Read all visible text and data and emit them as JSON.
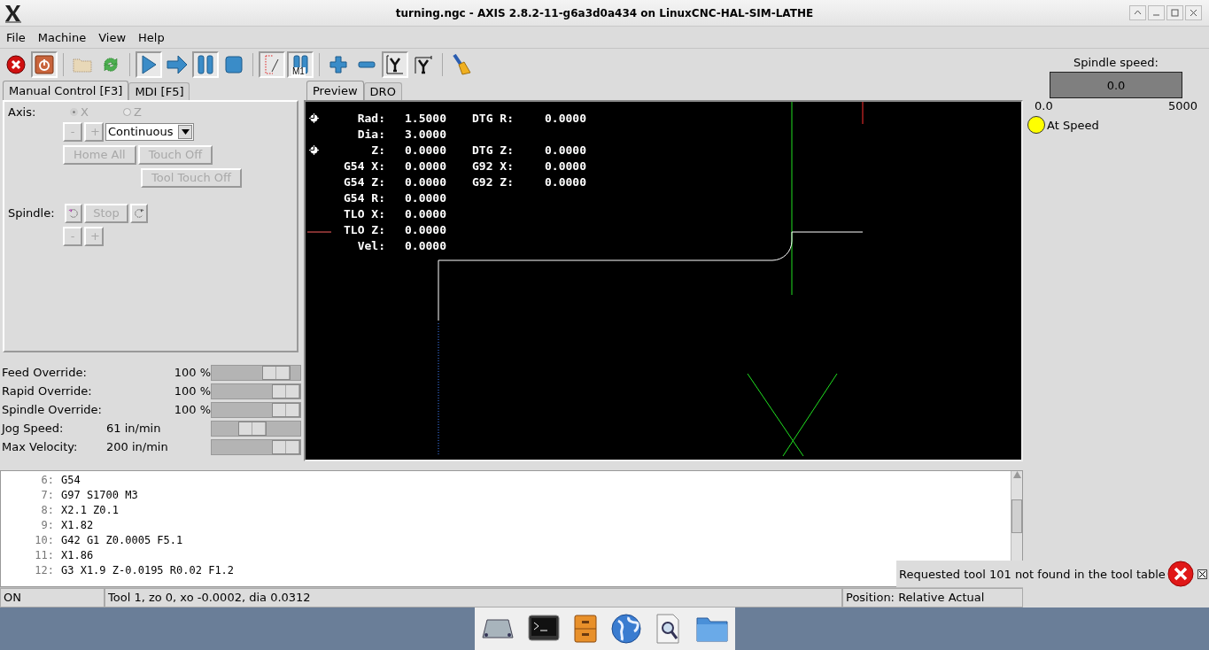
{
  "window": {
    "title": "turning.ngc - AXIS 2.8.2-11-g6a3d0a434 on LinuxCNC-HAL-SIM-LATHE"
  },
  "menu": [
    "File",
    "Machine",
    "View",
    "Help"
  ],
  "toolbar": [
    {
      "kind": "estop",
      "pressed": false
    },
    {
      "kind": "power",
      "pressed": true
    },
    {
      "kind": "sep"
    },
    {
      "kind": "open",
      "pressed": false
    },
    {
      "kind": "reload",
      "pressed": false
    },
    {
      "kind": "sep"
    },
    {
      "kind": "run",
      "pressed": true
    },
    {
      "kind": "step",
      "pressed": false
    },
    {
      "kind": "pause",
      "pressed": true
    },
    {
      "kind": "stop",
      "pressed": false
    },
    {
      "kind": "sep"
    },
    {
      "kind": "blockdelete",
      "pressed": true
    },
    {
      "kind": "optstop",
      "pressed": true,
      "label": "M1"
    },
    {
      "kind": "sep"
    },
    {
      "kind": "zoomin",
      "pressed": false
    },
    {
      "kind": "zoomout",
      "pressed": false
    },
    {
      "kind": "topview",
      "pressed": true
    },
    {
      "kind": "rotview",
      "pressed": false
    },
    {
      "kind": "sep"
    },
    {
      "kind": "clear",
      "pressed": false
    }
  ],
  "left_tabs": [
    {
      "label": "Manual Control [F3]",
      "selected": true
    },
    {
      "label": "MDI [F5]",
      "selected": false
    }
  ],
  "manual": {
    "axis_label": "Axis:",
    "axes": [
      {
        "label": "X",
        "selected": true
      },
      {
        "label": "Z",
        "selected": false
      }
    ],
    "jog_minus": "-",
    "jog_plus": "+",
    "jog_mode": "Continuous",
    "home_all": "Home All",
    "touch_off": "Touch Off",
    "tool_touch_off": "Tool Touch Off",
    "spindle_label": "Spindle:",
    "spindle_stop": "Stop",
    "spindle_minus": "-",
    "spindle_plus": "+",
    "disabled": true
  },
  "overrides": [
    {
      "label": "Feed Override:",
      "value": "100",
      "unit": "%",
      "level": 0.84
    },
    {
      "label": "Rapid Override:",
      "value": "100",
      "unit": "%",
      "level": 1.0
    },
    {
      "label": "Spindle Override:",
      "value": "100",
      "unit": "%",
      "level": 1.0
    },
    {
      "label": "Jog Speed:",
      "value": "61 in/min",
      "level": 0.44
    },
    {
      "label": "Max Velocity:",
      "value": "200 in/min",
      "level": 1.0
    }
  ],
  "preview_tabs": [
    {
      "label": "Preview",
      "selected": true
    },
    {
      "label": "DRO",
      "selected": false
    }
  ],
  "dro": [
    {
      "label": "Rad:",
      "value": "1.5000",
      "label2": "DTG R:",
      "value2": "0.0000",
      "homed": true
    },
    {
      "label": "Dia:",
      "value": "3.0000",
      "homed": false
    },
    {
      "label": "Z:",
      "value": "0.0000",
      "label2": "DTG Z:",
      "value2": "0.0000",
      "homed": true
    },
    {
      "label": "G54 X:",
      "value": "0.0000",
      "label2": "G92 X:",
      "value2": "0.0000",
      "homed": false
    },
    {
      "label": "G54 Z:",
      "value": "0.0000",
      "label2": "G92 Z:",
      "value2": "0.0000",
      "homed": false
    },
    {
      "label": "G54 R:",
      "value": "0.0000",
      "homed": false
    },
    {
      "label": "TLO X:",
      "value": "0.0000",
      "homed": false
    },
    {
      "label": "TLO Z:",
      "value": "0.0000",
      "homed": false
    },
    {
      "label": "Vel:",
      "value": "0.0000",
      "homed": false
    }
  ],
  "gcode": [
    {
      "line": "6:",
      "code": "G54"
    },
    {
      "line": "7:",
      "code": "G97 S1700 M3"
    },
    {
      "line": "8:",
      "code": "X2.1 Z0.1"
    },
    {
      "line": "9:",
      "code": "X1.82"
    },
    {
      "line": "10:",
      "code": "G42 G1 Z0.0005 F5.1"
    },
    {
      "line": "11:",
      "code": "X1.86"
    },
    {
      "line": "12:",
      "code": "G3 X1.9 Z-0.0195 R0.02 F1.2"
    }
  ],
  "spindle_panel": {
    "title": "Spindle speed:",
    "reading": "0.0",
    "level": 0,
    "min": "0.0",
    "max": "5000",
    "at_speed_label": "At Speed",
    "at_speed": true
  },
  "status_bar": {
    "state": "ON",
    "tool": "Tool 1, zo 0, xo -0.0002, dia 0.0312",
    "position": "Position: Relative Actual"
  },
  "notification": {
    "message": "Requested tool 101 not found in the tool table"
  },
  "dock": [
    {
      "kind": "drive"
    },
    {
      "kind": "terminal"
    },
    {
      "kind": "cabinet"
    },
    {
      "kind": "globe"
    },
    {
      "kind": "viewer"
    },
    {
      "kind": "folder"
    }
  ]
}
